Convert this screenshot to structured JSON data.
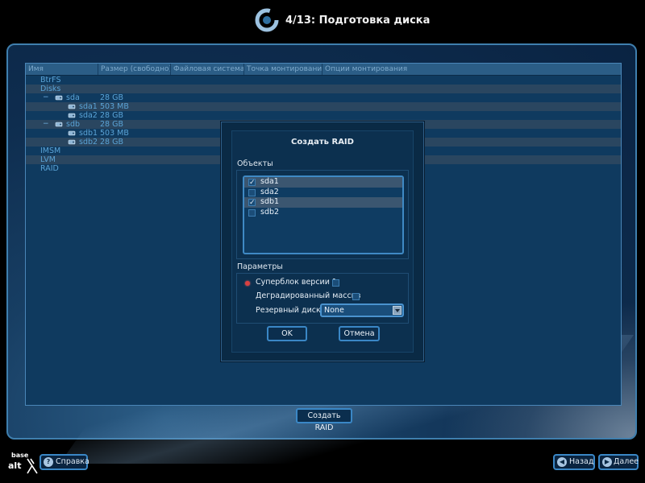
{
  "header": {
    "step_title": "4/13: Подготовка диска"
  },
  "tree": {
    "columns": [
      "Имя",
      "Размер (свободно)",
      "Файловая система",
      "Точка монтирования",
      "Опции монтирования"
    ],
    "rows": [
      {
        "name": "BtrFS",
        "size": "",
        "level": 0,
        "icon": "",
        "expander": ""
      },
      {
        "name": "Disks",
        "size": "",
        "level": 0,
        "icon": "",
        "expander": ""
      },
      {
        "name": "sda",
        "size": "28 GB",
        "level": 1,
        "icon": "disk-icon",
        "expander": "−"
      },
      {
        "name": "sda1",
        "size": "503 MB",
        "level": 2,
        "icon": "partition-icon",
        "expander": ""
      },
      {
        "name": "sda2",
        "size": "28 GB",
        "level": 2,
        "icon": "partition-icon",
        "expander": ""
      },
      {
        "name": "sdb",
        "size": "28 GB",
        "level": 1,
        "icon": "disk-icon",
        "expander": "−"
      },
      {
        "name": "sdb1",
        "size": "503 MB",
        "level": 2,
        "icon": "partition-icon",
        "expander": ""
      },
      {
        "name": "sdb2",
        "size": "28 GB",
        "level": 2,
        "icon": "partition-icon",
        "expander": ""
      },
      {
        "name": "IMSM",
        "size": "",
        "level": 0,
        "icon": "",
        "expander": ""
      },
      {
        "name": "LVM",
        "size": "",
        "level": 0,
        "icon": "",
        "expander": ""
      },
      {
        "name": "RAID",
        "size": "",
        "level": 0,
        "icon": "",
        "expander": ""
      }
    ]
  },
  "dialog": {
    "title": "Создать RAID",
    "objects_label": "Объекты",
    "objects": [
      {
        "label": "sda1",
        "checked": true,
        "highlight": true
      },
      {
        "label": "sda2",
        "checked": false,
        "highlight": false
      },
      {
        "label": "sdb1",
        "checked": true,
        "highlight": true
      },
      {
        "label": "sdb2",
        "checked": false,
        "highlight": false
      }
    ],
    "params_label": "Параметры",
    "superblock_label": "Суперблок версии 1",
    "degraded_label": "Деградированный массив",
    "spare_label": "Резервный диск",
    "spare_value": "None",
    "ok_label": "OK",
    "cancel_label": "Отмена"
  },
  "create_raid_button": "Создать RAID",
  "footer": {
    "help_label": "Справка",
    "back_label": "Назад",
    "next_label": "Далее",
    "brand_top": "base",
    "brand_bottom": "alt"
  },
  "colors": {
    "accent_border": "#3a87c6",
    "panel_bg": "#0f3a5f",
    "tree_text": "#5aa3d6",
    "radio_red": "#d94040"
  }
}
